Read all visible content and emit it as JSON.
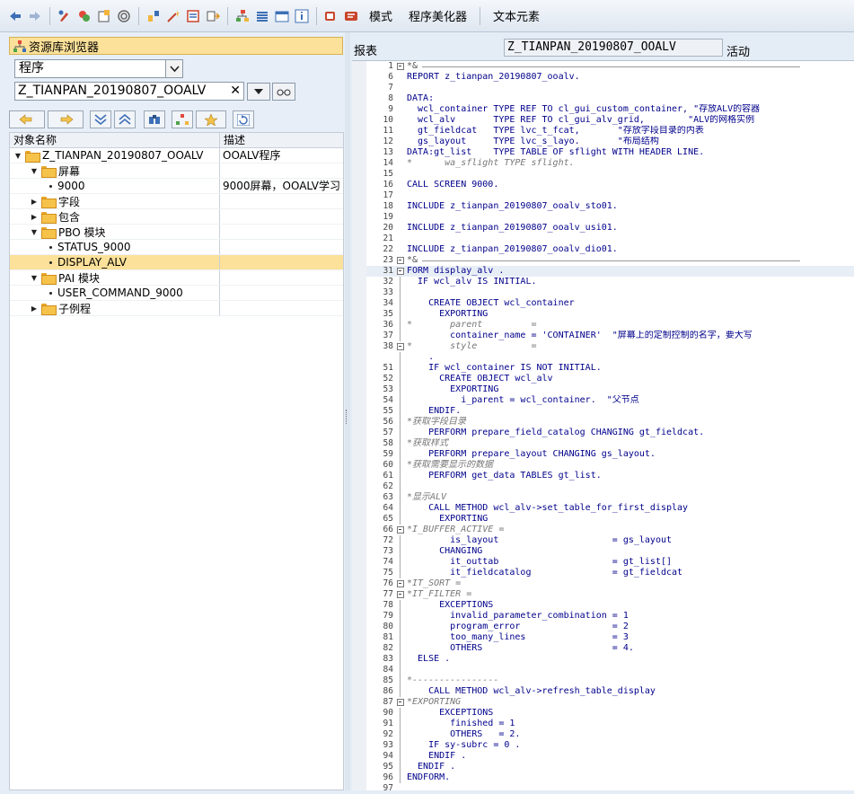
{
  "toolbar": {
    "text_buttons": [
      "模式",
      "程序美化器",
      "文本元素"
    ]
  },
  "browser": {
    "title": "资源库浏览器",
    "object_type": "程序",
    "object_name": "Z_TIANPAN_20190807_OOALV",
    "col_name": "对象名称",
    "col_desc": "描述",
    "tree": [
      {
        "label": "Z_TIANPAN_20190807_OOALV",
        "desc": "OOALV程序",
        "level": 0,
        "kind": "folder",
        "open": true
      },
      {
        "label": "屏幕",
        "desc": "",
        "level": 1,
        "kind": "folder",
        "open": true
      },
      {
        "label": "9000",
        "desc": "9000屏幕，OOALV学习",
        "level": 2,
        "kind": "item"
      },
      {
        "label": "字段",
        "desc": "",
        "level": 1,
        "kind": "folder",
        "open": false
      },
      {
        "label": "包含",
        "desc": "",
        "level": 1,
        "kind": "folder",
        "open": false
      },
      {
        "label": "PBO 模块",
        "desc": "",
        "level": 1,
        "kind": "folder",
        "open": true
      },
      {
        "label": "STATUS_9000",
        "desc": "",
        "level": 2,
        "kind": "item"
      },
      {
        "label": "DISPLAY_ALV",
        "desc": "",
        "level": 2,
        "kind": "item",
        "selected": true
      },
      {
        "label": "PAI 模块",
        "desc": "",
        "level": 1,
        "kind": "folder",
        "open": true
      },
      {
        "label": "USER_COMMAND_9000",
        "desc": "",
        "level": 2,
        "kind": "item"
      },
      {
        "label": "子例程",
        "desc": "",
        "level": 1,
        "kind": "folder",
        "open": false
      }
    ]
  },
  "editor": {
    "label": "报表",
    "program_name": "Z_TIANPAN_20190807_OOALV",
    "status": "活动",
    "lines": [
      {
        "n": "1",
        "t": "*&",
        "marker": "box",
        "cls": "sepline"
      },
      {
        "n": "6",
        "t": "REPORT z_tianpan_20190807_ooalv."
      },
      {
        "n": "7",
        "t": ""
      },
      {
        "n": "8",
        "t": "DATA:"
      },
      {
        "n": "9",
        "t": "  wcl_container TYPE REF TO cl_gui_custom_container, \"存放ALV的容器"
      },
      {
        "n": "10",
        "t": "  wcl_alv       TYPE REF TO cl_gui_alv_grid,        \"ALV的网格实例"
      },
      {
        "n": "11",
        "t": "  gt_fieldcat   TYPE lvc_t_fcat,       \"存放字段目录的内表"
      },
      {
        "n": "12",
        "t": "  gs_layout     TYPE lvc_s_layo.       \"布局结构"
      },
      {
        "n": "13",
        "t": "DATA:gt_list    TYPE TABLE OF sflight WITH HEADER LINE."
      },
      {
        "n": "14",
        "t": "*      wa_sflight TYPE sflight.",
        "cls": "cm"
      },
      {
        "n": "15",
        "t": ""
      },
      {
        "n": "16",
        "t": "CALL SCREEN 9000."
      },
      {
        "n": "17",
        "t": ""
      },
      {
        "n": "18",
        "t": "INCLUDE z_tianpan_20190807_ooalv_sto01."
      },
      {
        "n": "19",
        "t": ""
      },
      {
        "n": "20",
        "t": "INCLUDE z_tianpan_20190807_ooalv_usi01."
      },
      {
        "n": "21",
        "t": ""
      },
      {
        "n": "22",
        "t": "INCLUDE z_tianpan_20190807_ooalv_dio01."
      },
      {
        "n": "23",
        "t": "*&",
        "marker": "box",
        "cls": "sepline"
      },
      {
        "n": "31",
        "t": "FORM display_alv .",
        "marker": "box",
        "cls": "cur"
      },
      {
        "n": "32",
        "t": "  IF wcl_alv IS INITIAL.",
        "marker": "line"
      },
      {
        "n": "33",
        "t": "",
        "marker": "line"
      },
      {
        "n": "34",
        "t": "    CREATE OBJECT wcl_container",
        "marker": "line"
      },
      {
        "n": "35",
        "t": "      EXPORTING",
        "marker": "line"
      },
      {
        "n": "36",
        "t": "*       parent         =",
        "cls": "cm",
        "marker": "line"
      },
      {
        "n": "37",
        "t": "        container_name = 'CONTAINER'  \"屏幕上的定制控制的名字，要大写",
        "marker": "line"
      },
      {
        "n": "38",
        "t": "*       style          =",
        "cls": "cm",
        "marker": "box"
      },
      {
        "n": "",
        "t": "    .",
        "marker": "line"
      },
      {
        "n": "51",
        "t": "    IF wcl_container IS NOT INITIAL.",
        "marker": "line"
      },
      {
        "n": "52",
        "t": "      CREATE OBJECT wcl_alv",
        "marker": "line"
      },
      {
        "n": "53",
        "t": "        EXPORTING",
        "marker": "line"
      },
      {
        "n": "54",
        "t": "          i_parent = wcl_container.  \"父节点",
        "marker": "line"
      },
      {
        "n": "55",
        "t": "    ENDIF.",
        "marker": "line"
      },
      {
        "n": "56",
        "t": "*获取字段目录",
        "cls": "cm",
        "marker": "line"
      },
      {
        "n": "57",
        "t": "    PERFORM prepare_field_catalog CHANGING gt_fieldcat.",
        "marker": "line"
      },
      {
        "n": "58",
        "t": "*获取样式",
        "cls": "cm",
        "marker": "line"
      },
      {
        "n": "59",
        "t": "    PERFORM prepare_layout CHANGING gs_layout.",
        "marker": "line"
      },
      {
        "n": "60",
        "t": "*获取需要显示的数据",
        "cls": "cm",
        "marker": "line"
      },
      {
        "n": "61",
        "t": "    PERFORM get_data TABLES gt_list.",
        "marker": "line"
      },
      {
        "n": "62",
        "t": "",
        "marker": "line"
      },
      {
        "n": "63",
        "t": "*显示ALV",
        "cls": "cm",
        "marker": "line"
      },
      {
        "n": "64",
        "t": "    CALL METHOD wcl_alv->set_table_for_first_display",
        "marker": "line"
      },
      {
        "n": "65",
        "t": "      EXPORTING",
        "marker": "line"
      },
      {
        "n": "66",
        "t": "*I_BUFFER_ACTIVE =",
        "cls": "cm",
        "marker": "box"
      },
      {
        "n": "72",
        "t": "        is_layout                     = gs_layout",
        "marker": "line"
      },
      {
        "n": "73",
        "t": "      CHANGING",
        "marker": "line"
      },
      {
        "n": "74",
        "t": "        it_outtab                     = gt_list[]",
        "marker": "line"
      },
      {
        "n": "75",
        "t": "        it_fieldcatalog               = gt_fieldcat",
        "marker": "line"
      },
      {
        "n": "76",
        "t": "*IT_SORT =",
        "cls": "cm",
        "marker": "box"
      },
      {
        "n": "77",
        "t": "*IT_FILTER =",
        "cls": "cm",
        "marker": "box"
      },
      {
        "n": "78",
        "t": "      EXCEPTIONS",
        "marker": "line"
      },
      {
        "n": "79",
        "t": "        invalid_parameter_combination = 1",
        "marker": "line"
      },
      {
        "n": "80",
        "t": "        program_error                 = 2",
        "marker": "line"
      },
      {
        "n": "81",
        "t": "        too_many_lines                = 3",
        "marker": "line"
      },
      {
        "n": "82",
        "t": "        OTHERS                        = 4.",
        "marker": "line"
      },
      {
        "n": "83",
        "t": "  ELSE .",
        "marker": "line"
      },
      {
        "n": "84",
        "t": "",
        "marker": "line"
      },
      {
        "n": "85",
        "t": "*----------------",
        "cls": "cm",
        "marker": "line"
      },
      {
        "n": "86",
        "t": "    CALL METHOD wcl_alv->refresh_table_display",
        "marker": "line"
      },
      {
        "n": "87",
        "t": "*EXPORTING",
        "cls": "cm",
        "marker": "box"
      },
      {
        "n": "90",
        "t": "      EXCEPTIONS",
        "marker": "line"
      },
      {
        "n": "91",
        "t": "        finished = 1",
        "marker": "line"
      },
      {
        "n": "92",
        "t": "        OTHERS   = 2.",
        "marker": "line"
      },
      {
        "n": "93",
        "t": "    IF sy-subrc = 0 .",
        "marker": "line"
      },
      {
        "n": "94",
        "t": "    ENDIF .",
        "marker": "line"
      },
      {
        "n": "95",
        "t": "  ENDIF .",
        "marker": "line"
      },
      {
        "n": "96",
        "t": "ENDFORM.",
        "marker": "line"
      },
      {
        "n": "97",
        "t": ""
      }
    ]
  }
}
